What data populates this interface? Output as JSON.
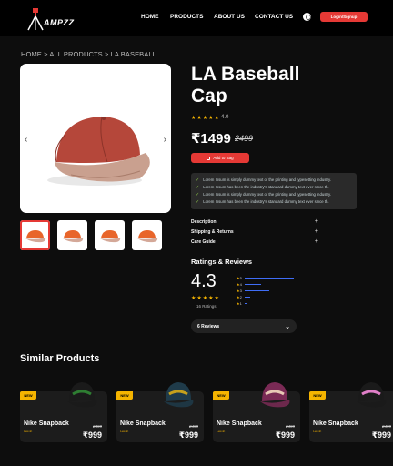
{
  "header": {
    "logo_text": "AMPZZ",
    "nav": [
      "HOME",
      "PRODUCTS",
      "ABOUT US",
      "CONTACT US"
    ],
    "login_label": "Login/Signup"
  },
  "breadcrumb": "HOME > ALL PRODUCTS > LA BASEBALL",
  "product": {
    "title": "LA Baseball Cap",
    "rating_stars": "★★★★★",
    "rating": "4.0",
    "price": "₹1499",
    "old_price": "2499",
    "wishlist_label": "Add to Bag",
    "features": [
      "Lorem Ipsum is simply dummy text of the printing and typesetting industry.",
      "Lorem Ipsum has been the industry's standard dummy text ever since th.",
      "Lorem Ipsum is simply dummy text of the printing and typesetting industry.",
      "Lorem Ipsum has been the industry's standard dummy text ever since th."
    ],
    "accordions": [
      "Description",
      "Shipping & Returns",
      "Care Guide"
    ],
    "cap_color": "#b5473a"
  },
  "ratings": {
    "title": "Ratings & Reviews",
    "average": "4.3",
    "stars": "★★★★★",
    "count_label": "16 Ratings",
    "breakdown": [
      {
        "label": "5",
        "fraction": 0.9
      },
      {
        "label": "4",
        "fraction": 0.3
      },
      {
        "label": "3",
        "fraction": 0.45
      },
      {
        "label": "2",
        "fraction": 0.1
      },
      {
        "label": "1",
        "fraction": 0.05
      }
    ],
    "reviews_label": "6 Reviews"
  },
  "similar": {
    "title": "Similar Products",
    "items": [
      {
        "badge": "NEW",
        "name": "Nike Snapback",
        "brand": "NIKE",
        "old_price": "2499",
        "price": "₹999",
        "color": "#1a1a1a",
        "accent": "#2e7d32"
      },
      {
        "badge": "NEW",
        "name": "Nike Snapback",
        "brand": "NIKE",
        "old_price": "2499",
        "price": "₹999",
        "color": "#1f3b4a",
        "accent": "#c6a11c"
      },
      {
        "badge": "NEW",
        "name": "Nike Snapback",
        "brand": "NIKE",
        "old_price": "2499",
        "price": "₹999",
        "color": "#7a2a55",
        "accent": "#e8c9b6"
      },
      {
        "badge": "NEW",
        "name": "Nike Snapback",
        "brand": "NIKE",
        "old_price": "2499",
        "price": "₹999",
        "color": "#1a1a1a",
        "accent": "#e07fc8"
      }
    ]
  },
  "colors": {
    "accent": "#e53935",
    "star": "#f5b400",
    "bar": "#3f6df6"
  }
}
